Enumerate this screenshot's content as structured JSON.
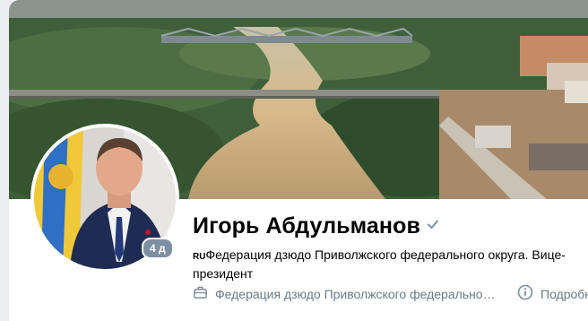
{
  "profile": {
    "name": "Игорь Абдульманов",
    "online_label": "4 д",
    "status_lang": "RU",
    "status_text": "Федерация дзюдо Приволжского федерального округа. Вице-президент"
  },
  "info": {
    "work_text": "Федерация дзюдо Приволжского федерального округа",
    "more_label": "Подробнее"
  },
  "icons": [
    "verified-icon",
    "briefcase-icon",
    "info-icon"
  ],
  "colors": {
    "accent": "#2688eb",
    "muted": "#6d7885",
    "badge": "#7f8fa2"
  }
}
